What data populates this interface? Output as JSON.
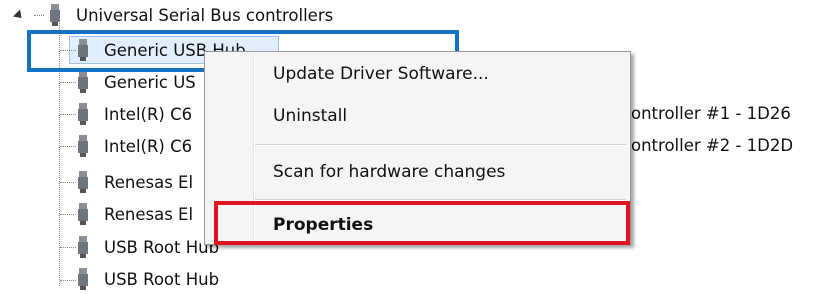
{
  "tree": {
    "category_label": "Universal Serial Bus controllers",
    "items": [
      "Generic USB Hub",
      "Generic US",
      "Intel(R) C6",
      "Intel(R) C6",
      "Renesas El",
      "Renesas El",
      "USB Root Hub",
      "USB Root Hub"
    ],
    "item3_trailing": "ontroller #1 - 1D26",
    "item4_trailing": "ontroller #2 - 1D2D"
  },
  "context_menu": {
    "update_driver": "Update Driver Software...",
    "uninstall": "Uninstall",
    "scan": "Scan for hardware changes",
    "properties": "Properties"
  },
  "colors": {
    "selection_highlight": "#1272c4",
    "properties_highlight": "#e0141e"
  }
}
